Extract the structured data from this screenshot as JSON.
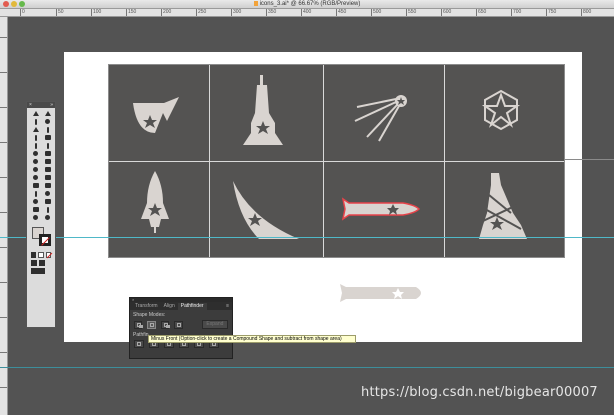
{
  "window": {
    "title": "icons_3.ai* @ 66.67% (RGB/Preview)"
  },
  "ruler": {
    "top_labels": [
      "0",
      "50",
      "100",
      "150",
      "200",
      "250",
      "300",
      "350",
      "400",
      "450",
      "500",
      "550",
      "600",
      "650",
      "700",
      "750",
      "800"
    ],
    "left_labels": [
      "0",
      "5",
      "1",
      "1",
      "5",
      "2",
      "0",
      "2",
      "5",
      "3",
      "0",
      "3",
      "5",
      "4",
      "0"
    ]
  },
  "artboard": {
    "icons": [
      "satellite-dish-star-icon",
      "tower-star-icon",
      "sputnik-star-icon",
      "hexagon-star-icon",
      "rocket-star-icon",
      "sail-star-icon",
      "missile-star-icon",
      "crumbling-tower-star-icon"
    ],
    "extra_shape": "capsule-star-icon"
  },
  "tools": {
    "fill_color": "#d9d4d0",
    "stroke_color": "#222222"
  },
  "pathfinder": {
    "tabs": [
      "Transform",
      "Align",
      "Pathfinder"
    ],
    "active_tab": "Pathfinder",
    "shape_modes_label": "Shape Modes:",
    "pathfinders_label": "Pathfin",
    "expand_label": "Expand",
    "menu_glyph": "≡"
  },
  "tooltip": {
    "text": "Minus Front (Option-click to create a Compound Shape and subtract from shape area)"
  },
  "watermark": {
    "text": "https://blog.csdn.net/bigbear00007"
  },
  "colors": {
    "pasteboard": "#535353",
    "artboard": "#ffffff",
    "icon_grid": "#545352",
    "icon_fill": "#d9d4d0",
    "selection_outline": "#e8434a",
    "guide": "#4fb8c8",
    "tooltip_bg": "#ffffcf"
  }
}
